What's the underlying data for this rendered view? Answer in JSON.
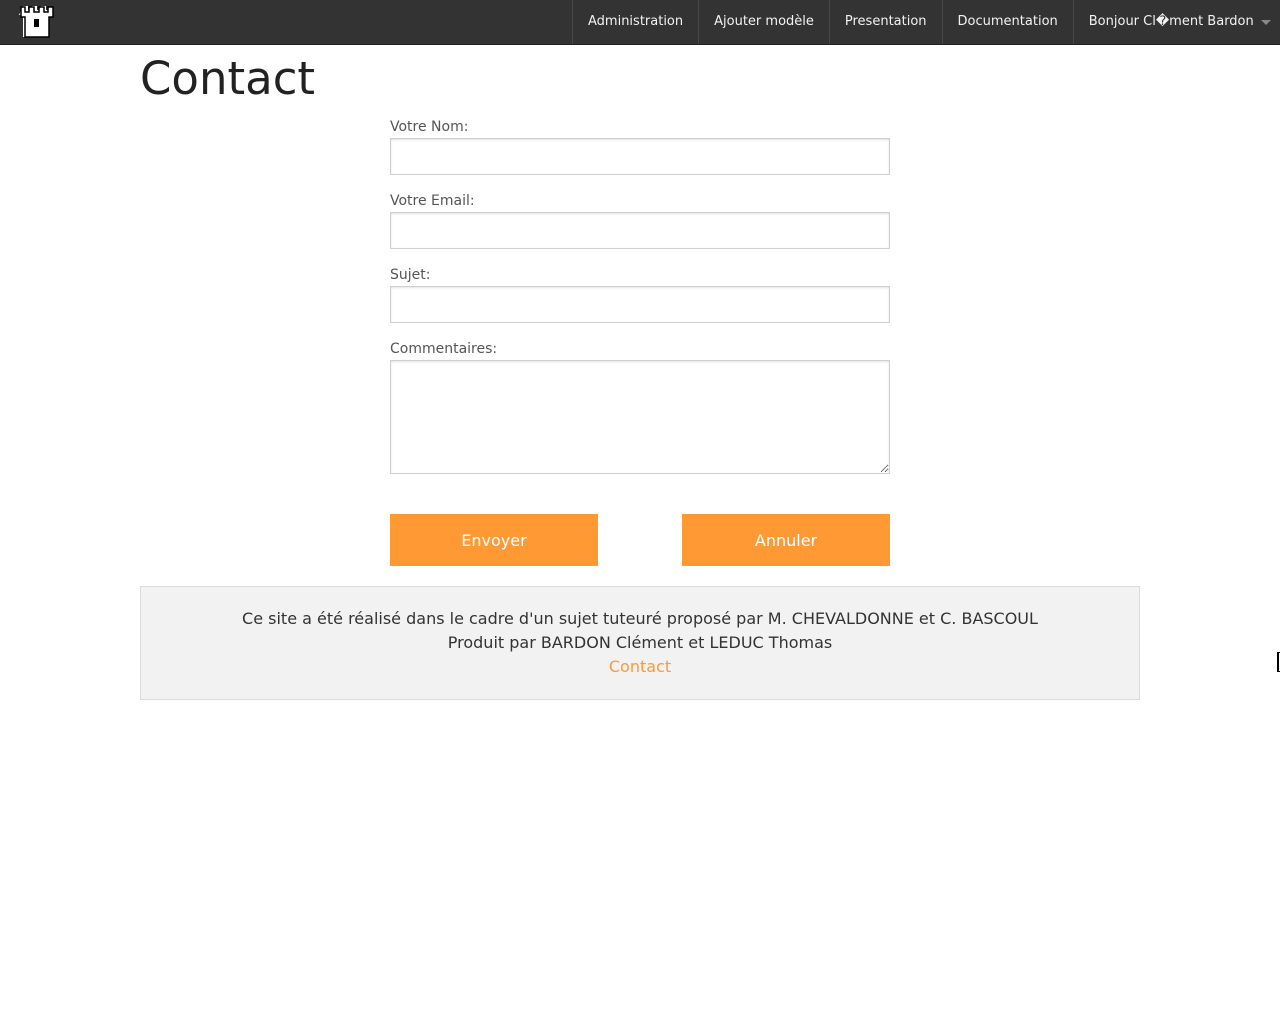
{
  "navbar": {
    "logo_icon": "castle-tower-icon",
    "items": [
      {
        "label": "Administration"
      },
      {
        "label": "Ajouter modèle"
      },
      {
        "label": "Presentation"
      },
      {
        "label": "Documentation"
      }
    ],
    "user_menu_label": "Bonjour Cl�ment Bardon",
    "user_menu_icon": "caret-down-icon"
  },
  "page": {
    "title": "Contact"
  },
  "form": {
    "name_label": "Votre Nom:",
    "name_value": "",
    "email_label": "Votre Email:",
    "email_value": "",
    "subject_label": "Sujet:",
    "subject_value": "",
    "comments_label": "Commentaires:",
    "comments_value": "",
    "send_label": "Envoyer",
    "cancel_label": "Annuler"
  },
  "footer": {
    "line1": "Ce site a été réalisé dans le cadre d'un sujet tuteuré proposé par M. CHEVALDONNE et C. BASCOUL",
    "line2": "Produit par BARDON Clément et LEDUC Thomas",
    "contact_link": "Contact"
  },
  "colors": {
    "navbar_bg": "#333333",
    "accent": "#ff9933",
    "footer_bg": "#f2f2f2"
  }
}
